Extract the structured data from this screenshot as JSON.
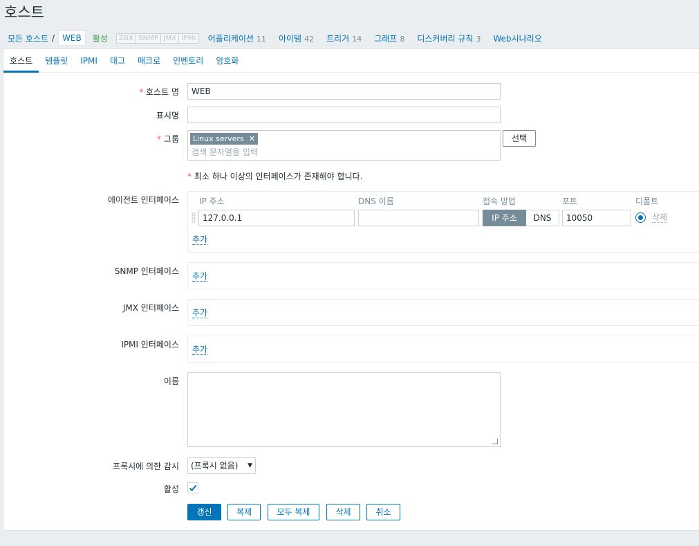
{
  "page": {
    "title": "호스트"
  },
  "breadcrumb": {
    "all_hosts": "모든 호스트",
    "separator": "/",
    "current": "WEB",
    "status": "활성",
    "availability": [
      "ZBX",
      "SNMP",
      "JMX",
      "IPMI"
    ],
    "items": [
      {
        "label": "어플리케이션",
        "count": "11"
      },
      {
        "label": "아이템",
        "count": "42"
      },
      {
        "label": "트리거",
        "count": "14"
      },
      {
        "label": "그래프",
        "count": "8"
      },
      {
        "label": "디스커버리 규칙",
        "count": "3"
      },
      {
        "label": "Web시나리오",
        "count": ""
      }
    ]
  },
  "tabs": [
    "호스트",
    "템플릿",
    "IPMI",
    "태그",
    "매크로",
    "인벤토리",
    "암호화"
  ],
  "form": {
    "host_name_label": "호스트 명",
    "host_name_value": "WEB",
    "visible_name_label": "표시명",
    "visible_name_value": "",
    "groups_label": "그룹",
    "group_chip": "Linux servers",
    "groups_placeholder": "검색 문자열을 입력",
    "select_button": "선택",
    "interface_note": "최소 하나 이상의 인터페이스가 존재해야 합니다.",
    "agent_if_label": "에이전트 인터페이스",
    "snmp_if_label": "SNMP 인터페이스",
    "jmx_if_label": "JMX 인터페이스",
    "ipmi_if_label": "IPMI 인터페이스",
    "iface_headers": {
      "ip": "IP 주소",
      "dns": "DNS 이름",
      "connect": "접속 방법",
      "port": "포트",
      "default": "디폴트"
    },
    "agent_ip": "127.0.0.1",
    "agent_dns": "",
    "connect_ip": "IP 주소",
    "connect_dns": "DNS",
    "agent_port": "10050",
    "remove_link": "삭제",
    "add_link": "추가",
    "description_label": "이름",
    "description_value": "",
    "proxy_label": "프록시에 의한 감시",
    "proxy_value": "(프록시 없음)",
    "enabled_label": "활성",
    "enabled_checked": true
  },
  "buttons": {
    "update": "갱신",
    "clone": "복제",
    "full_clone": "모두 복제",
    "delete": "삭제",
    "cancel": "취소"
  }
}
